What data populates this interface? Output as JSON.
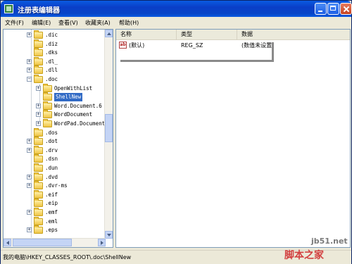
{
  "window": {
    "title": "注册表编辑器"
  },
  "menu": [
    "文件(F)",
    "编辑(E)",
    "查看(V)",
    "收藏夹(A)",
    "帮助(H)"
  ],
  "tree": [
    {
      "label": ".dic",
      "expander": "+"
    },
    {
      "label": ".diz",
      "expander": ""
    },
    {
      "label": ".dks",
      "expander": ""
    },
    {
      "label": ".dl_",
      "expander": "+"
    },
    {
      "label": ".dll",
      "expander": "+"
    },
    {
      "label": ".doc",
      "expander": "−"
    },
    {
      "label": "OpenWithList",
      "expander": "+",
      "child": true
    },
    {
      "label": "ShellNew",
      "expander": "",
      "child": true,
      "selected": true
    },
    {
      "label": "Word.Document.6",
      "expander": "+",
      "child": true
    },
    {
      "label": "WordDocument",
      "expander": "+",
      "child": true
    },
    {
      "label": "WordPad.Document.",
      "expander": "+",
      "child": true
    },
    {
      "label": ".dos",
      "expander": ""
    },
    {
      "label": ".dot",
      "expander": "+"
    },
    {
      "label": ".drv",
      "expander": "+"
    },
    {
      "label": ".dsn",
      "expander": ""
    },
    {
      "label": ".dun",
      "expander": ""
    },
    {
      "label": ".dvd",
      "expander": "+"
    },
    {
      "label": ".dvr-ms",
      "expander": "+"
    },
    {
      "label": ".eif",
      "expander": ""
    },
    {
      "label": ".eip",
      "expander": ""
    },
    {
      "label": ".emf",
      "expander": "+"
    },
    {
      "label": ".eml",
      "expander": ""
    },
    {
      "label": ".eps",
      "expander": "+"
    }
  ],
  "list": {
    "columns": [
      "名称",
      "类型",
      "数据"
    ],
    "rows": [
      {
        "name": "(默认)",
        "type": "REG_SZ",
        "data": "(数值未设置)"
      }
    ]
  },
  "status": {
    "path": "我的电脑\\HKEY_CLASSES_ROOT\\.doc\\ShellNew"
  },
  "watermark": {
    "site": "jb51.net",
    "brand": "脚本之家"
  },
  "colors": {
    "titlebar": "#0a5be1",
    "selection": "#316ac5"
  }
}
